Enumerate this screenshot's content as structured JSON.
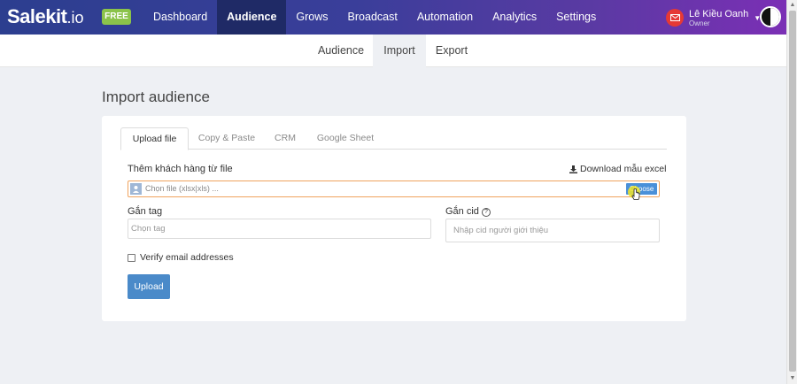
{
  "brand": {
    "name": "Salekit",
    "tld": ".io",
    "badge": "FREE"
  },
  "nav": {
    "items": [
      {
        "label": "Dashboard",
        "active": false
      },
      {
        "label": "Audience",
        "active": true
      },
      {
        "label": "Grows",
        "active": false
      },
      {
        "label": "Broadcast",
        "active": false
      },
      {
        "label": "Automation",
        "active": false
      },
      {
        "label": "Analytics",
        "active": false
      },
      {
        "label": "Settings",
        "active": false
      }
    ]
  },
  "user": {
    "name": "Lê Kiều Oanh",
    "role": "Owner"
  },
  "subnav": {
    "items": [
      {
        "label": "Audience",
        "active": false
      },
      {
        "label": "Import",
        "active": true
      },
      {
        "label": "Export",
        "active": false
      }
    ]
  },
  "page": {
    "title": "Import audience"
  },
  "tabs": [
    {
      "label": "Upload file",
      "active": true
    },
    {
      "label": "Copy & Paste",
      "active": false
    },
    {
      "label": "CRM",
      "active": false
    },
    {
      "label": "Google Sheet",
      "active": false
    }
  ],
  "form": {
    "file_label": "Thêm khách hàng từ file",
    "download_label": "Download mẫu excel",
    "file_placeholder": "Chọn file (xlsx|xls) ...",
    "choose_label": "Choose",
    "tag_label": "Gắn tag",
    "tag_placeholder": "Chọn tag",
    "cid_label": "Gắn cid",
    "cid_placeholder": "Nhập cid người giới thiệu",
    "verify_label": "Verify email addresses",
    "verify_checked": false,
    "upload_label": "Upload"
  },
  "colors": {
    "accent": "#4a90d9",
    "badge": "#8bc34a",
    "file_border": "#f0a35e",
    "mail": "#e53935"
  }
}
